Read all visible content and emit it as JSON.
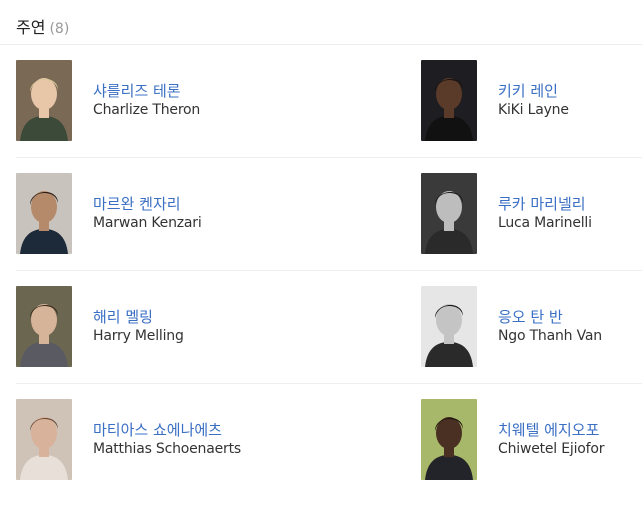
{
  "section": {
    "title": "주연",
    "count": "(8)"
  },
  "cast": [
    {
      "name_ko": "샤를리즈 테론",
      "name_en": "Charlize Theron",
      "photo_bg": "#7a6a55",
      "skin": "#e8c6a8",
      "hair": "#d9c79a",
      "shirt": "#3c4a3a"
    },
    {
      "name_ko": "키키 레인",
      "name_en": "KiKi Layne",
      "photo_bg": "#1e1e22",
      "skin": "#5a3a28",
      "hair": "#1a1210",
      "shirt": "#111111"
    },
    {
      "name_ko": "마르완 켄자리",
      "name_en": "Marwan Kenzari",
      "photo_bg": "#c9c3bd",
      "skin": "#b48a6a",
      "hair": "#2a1c14",
      "shirt": "#1d2a3a"
    },
    {
      "name_ko": "루카 마리넬리",
      "name_en": "Luca Marinelli",
      "photo_bg": "#3a3a3a",
      "skin": "#bdbdbd",
      "hair": "#1c1c1c",
      "shirt": "#2a2a2a"
    },
    {
      "name_ko": "해리 멜링",
      "name_en": "Harry Melling",
      "photo_bg": "#6a6650",
      "skin": "#d6b49a",
      "hair": "#3a2a1c",
      "shirt": "#5a5a62"
    },
    {
      "name_ko": "응오 탄 반",
      "name_en": "Ngo Thanh Van",
      "photo_bg": "#e6e6e6",
      "skin": "#c4c4c4",
      "hair": "#161616",
      "shirt": "#2a2a2a"
    },
    {
      "name_ko": "마티아스 쇼에나에츠",
      "name_en": "Matthias Schoenaerts",
      "photo_bg": "#cfc3b8",
      "skin": "#d8b29a",
      "hair": "#6a4a34",
      "shirt": "#e8e0d8"
    },
    {
      "name_ko": "치웨텔 에지오포",
      "name_en": "Chiwetel Ejiofor",
      "photo_bg": "#a8b86a",
      "skin": "#4a3022",
      "hair": "#1a120c",
      "shirt": "#22242a"
    }
  ]
}
